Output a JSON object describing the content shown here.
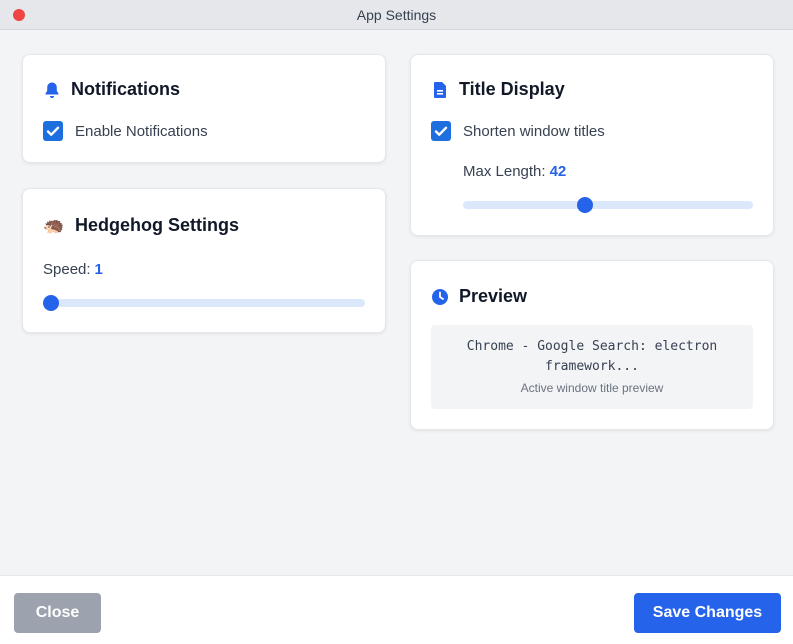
{
  "window": {
    "title": "App Settings"
  },
  "notifications": {
    "title": "Notifications",
    "enable_label": "Enable Notifications",
    "enabled": true
  },
  "hedgehog": {
    "title": "Hedgehog Settings",
    "icon": "🦔",
    "speed_label": "Speed:",
    "speed_value": "1",
    "speed_fraction": 0.0
  },
  "title_display": {
    "title": "Title Display",
    "shorten_label": "Shorten window titles",
    "shorten_enabled": true,
    "max_length_label": "Max Length:",
    "max_length_value": "42",
    "max_length_fraction": 0.42
  },
  "preview": {
    "title": "Preview",
    "text": "Chrome - Google Search: electron framework...",
    "caption": "Active window title preview"
  },
  "footer": {
    "close_label": "Close",
    "save_label": "Save Changes"
  },
  "colors": {
    "accent": "#2563eb",
    "close_button": "#9ca3af",
    "traffic_red": "#ef4444"
  },
  "icons": {
    "notifications": "bell-icon",
    "title_display": "document-icon",
    "preview": "clock-icon",
    "checkbox": "checkmark-icon"
  }
}
